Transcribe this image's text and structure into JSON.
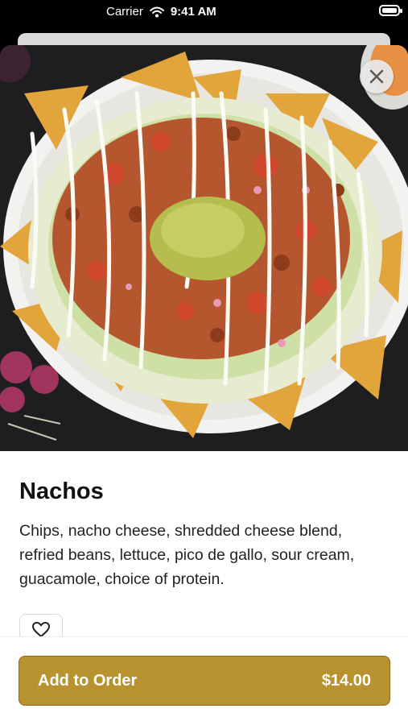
{
  "status_bar": {
    "carrier": "Carrier",
    "time": "9:41 AM"
  },
  "product": {
    "name": "Nachos",
    "description": "Chips, nacho cheese, shredded cheese blend, refried beans, lettuce, pico de gallo, sour cream, guacamole, choice of protein.",
    "image_alt": "Nachos"
  },
  "actions": {
    "add_label": "Add to Order",
    "price": "$14.00"
  },
  "icons": {
    "close": "close-icon",
    "favorite": "heart-icon",
    "wifi": "wifi-icon",
    "battery": "battery-icon"
  },
  "colors": {
    "accent": "#b8922f"
  }
}
